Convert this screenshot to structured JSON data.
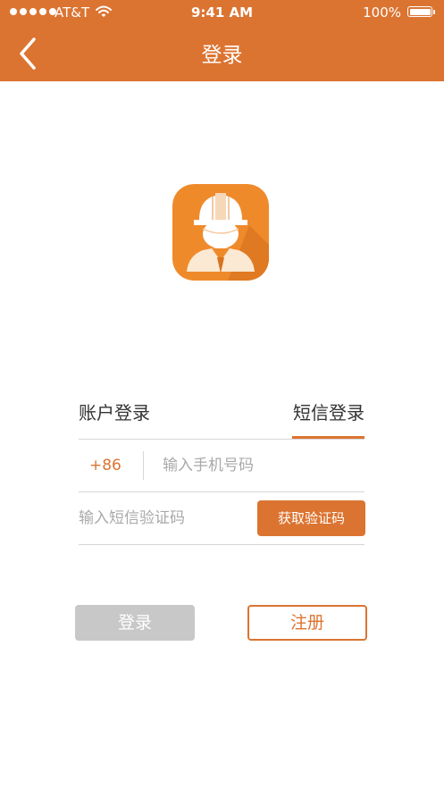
{
  "status_bar": {
    "carrier": "AT&T",
    "time": "9:41 AM",
    "battery": "100%",
    "battery_level": 1.0,
    "signal_icon": "signal-dots-icon",
    "wifi_icon": "wifi-icon",
    "battery_icon": "battery-icon"
  },
  "nav": {
    "title": "登录",
    "back_icon": "chevron-left-icon"
  },
  "logo": {
    "icon": "worker-helmet-avatar-icon"
  },
  "tabs": [
    {
      "label": "账户登录",
      "active": false
    },
    {
      "label": "短信登录",
      "active": true
    }
  ],
  "form": {
    "country_code": "+86",
    "phone_placeholder": "输入手机号码",
    "phone_value": "",
    "code_placeholder": "输入短信验证码",
    "code_value": "",
    "get_code_label": "获取验证码"
  },
  "actions": {
    "login_label": "登录",
    "register_label": "注册"
  },
  "colors": {
    "brand": "#dc7431",
    "disabled_button": "#c8c8c8",
    "divider": "#d6d6d6",
    "placeholder": "#a9a9a9",
    "text": "#333333"
  }
}
